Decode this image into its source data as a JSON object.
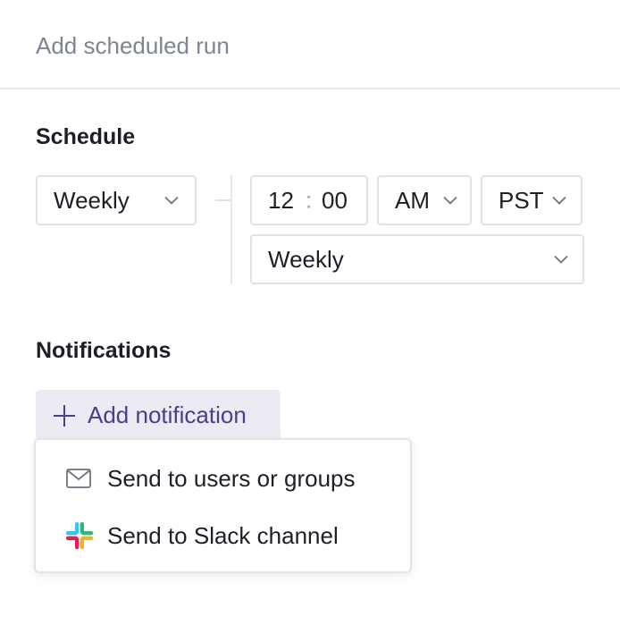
{
  "header": {
    "title": "Add scheduled run"
  },
  "schedule": {
    "section_title": "Schedule",
    "frequency": {
      "value": "Weekly",
      "icon": "chevron-down-icon"
    },
    "time": {
      "hour": "12",
      "separator": ":",
      "minute": "00"
    },
    "period": {
      "value": "AM",
      "icon": "chevron-down-icon"
    },
    "timezone": {
      "value": "PST",
      "icon": "chevron-down-icon"
    },
    "repeat": {
      "value": "Weekly",
      "icon": "chevron-down-icon"
    }
  },
  "notifications": {
    "section_title": "Notifications",
    "add_button": {
      "label": "Add notification",
      "icon": "plus-icon"
    },
    "menu": {
      "items": [
        {
          "label": "Send to users or groups",
          "icon": "envelope-icon"
        },
        {
          "label": "Send to Slack channel",
          "icon": "slack-icon"
        }
      ]
    }
  },
  "colors": {
    "accent_text": "#4a3d8c",
    "accent_bg": "#ecebf3",
    "muted_text": "#7d8494",
    "border": "#dfe1e6",
    "slack_blue": "#36c5f0",
    "slack_green": "#2eb67d",
    "slack_yellow": "#ecb22e",
    "slack_red": "#e01e5a"
  }
}
